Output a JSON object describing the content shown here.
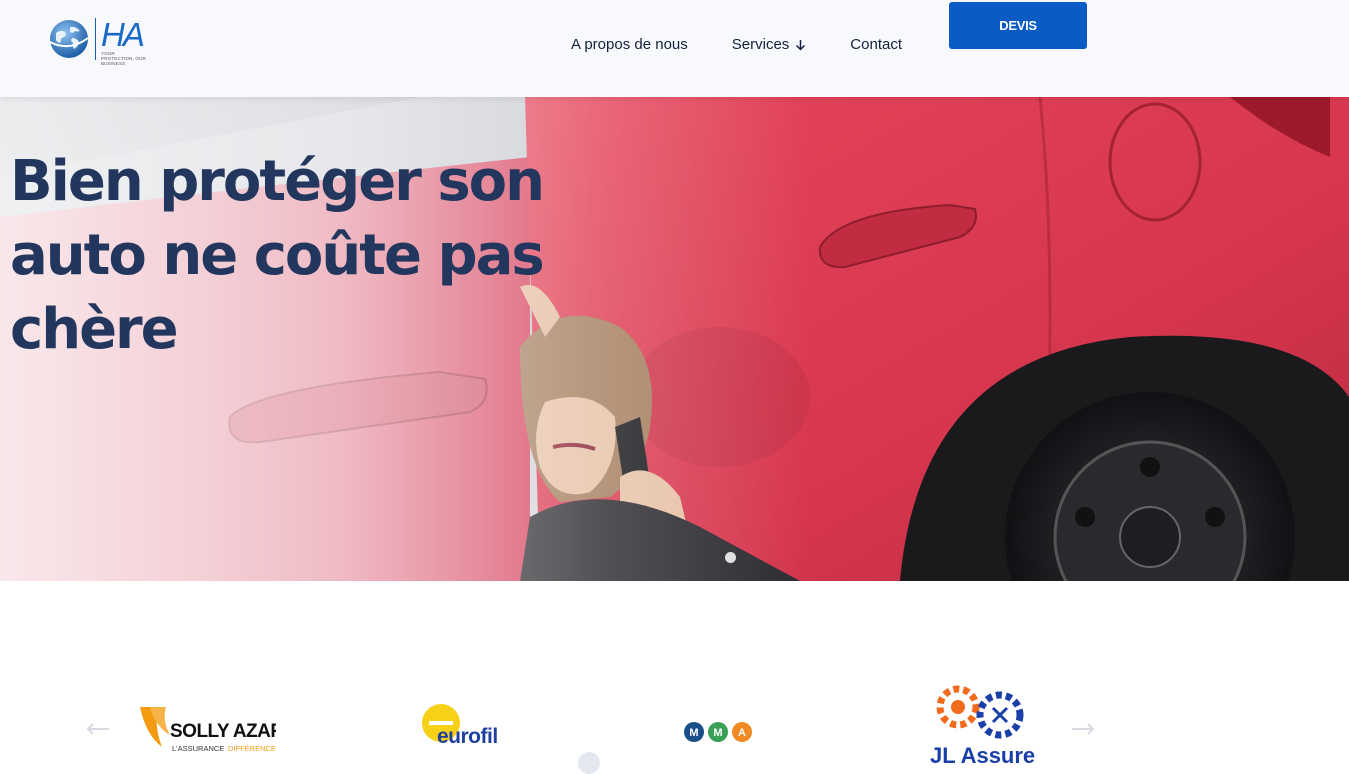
{
  "header": {
    "logo": {
      "mark": "HA",
      "tagline": "YOUR PROTECTION, OUR BUSINESS",
      "icon": "globe-icon"
    },
    "nav": [
      {
        "label": "A propos de nous"
      },
      {
        "label": "Services",
        "icon": "arrow-down-icon"
      },
      {
        "label": "Contact"
      }
    ],
    "cta_label": "DEVIS"
  },
  "hero": {
    "title": "Bien protéger son auto ne coûte pas chère",
    "slide_index": 1
  },
  "partners": {
    "prev_icon": "arrow-left-icon",
    "next_icon": "arrow-right-icon",
    "logos": [
      {
        "name": "SOLLY AZAR",
        "tagline_a": "L'ASSURANCE",
        "tagline_b": "DIFFÉRENCE"
      },
      {
        "name": "eurofil"
      },
      {
        "name": "MMA",
        "letters": [
          "M",
          "M",
          "A"
        ]
      },
      {
        "name": "JL Assure"
      }
    ]
  },
  "colors": {
    "brand_blue": "#0a5bc4",
    "title_navy": "#23375e",
    "car_red": "#d8324a",
    "solly_orange": "#f39c12",
    "eurofil_yellow": "#f7d117",
    "mma_blue": "#1b4f8a",
    "mma_green": "#3aa056",
    "mma_orange": "#f08a24",
    "jl_orange": "#f26a1b",
    "jl_blue": "#1b3fa8"
  }
}
